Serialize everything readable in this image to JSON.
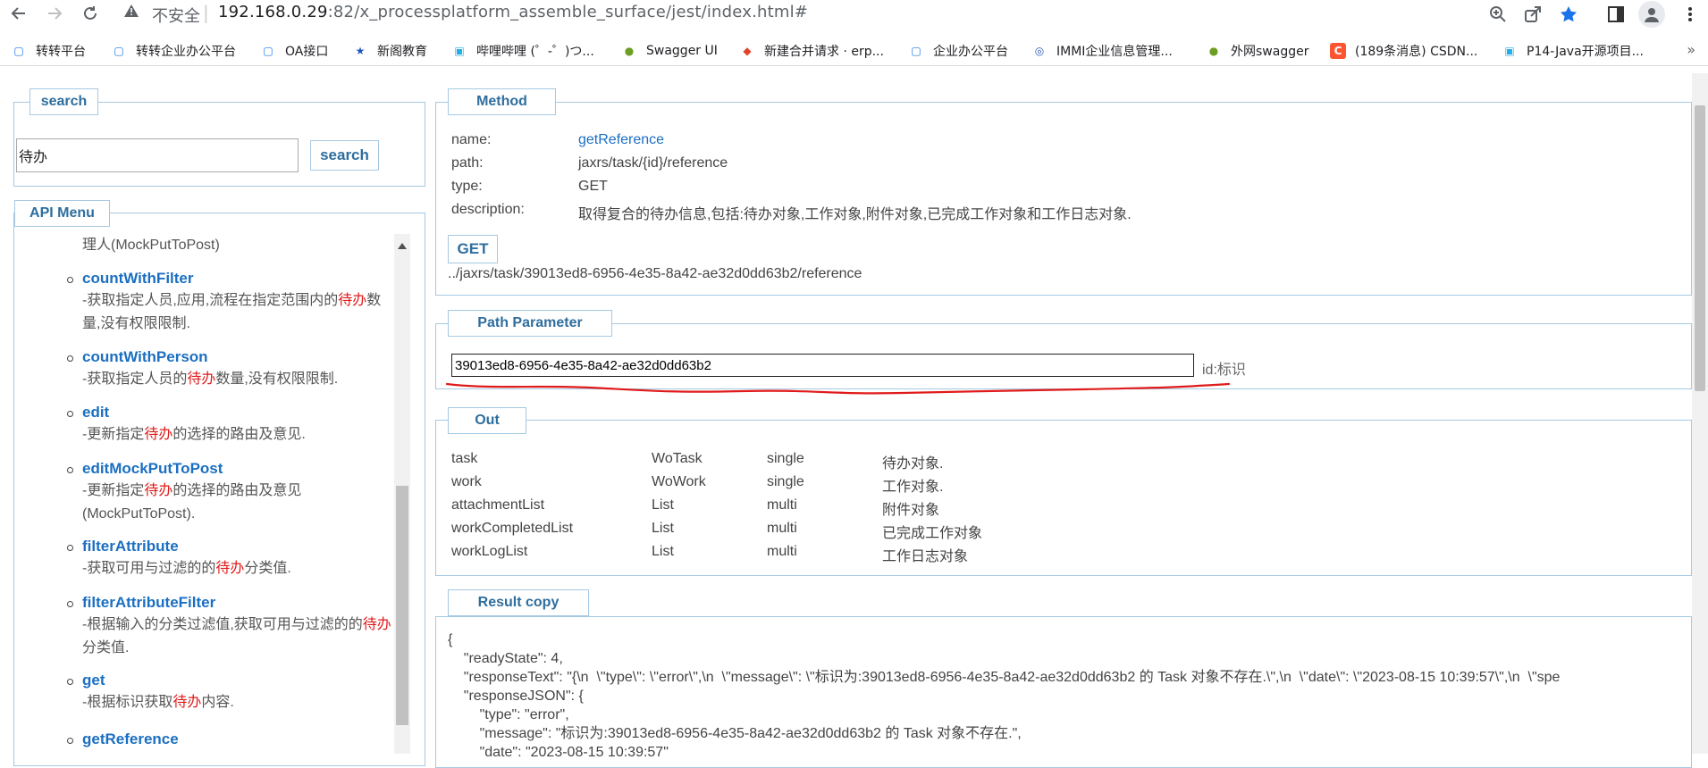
{
  "browser": {
    "insecure_label": "不安全",
    "url_host": "192.168.0.29",
    "url_rest": ":82/x_processplatform_assemble_surface/jest/index.html#"
  },
  "bookmarks": [
    {
      "label": "转转平台",
      "icon": "doc-icon",
      "color": "#1a73e8"
    },
    {
      "label": "转转企业办公平台",
      "icon": "doc-icon",
      "color": "#1a73e8"
    },
    {
      "label": "OA接口",
      "icon": "doc-icon",
      "color": "#1a73e8"
    },
    {
      "label": "新阁教育",
      "icon": "star-icon",
      "color": "#1a57c2"
    },
    {
      "label": "哔哩哔哩 (゜-゜)つ...",
      "icon": "bilibili-icon",
      "color": "#23ade5"
    },
    {
      "label": "Swagger UI",
      "icon": "swagger-icon",
      "color": "#6b9e23"
    },
    {
      "label": "新建合并请求 · erp...",
      "icon": "gitlab-icon",
      "color": "#e24329"
    },
    {
      "label": "企业办公平台",
      "icon": "doc-icon",
      "color": "#1a73e8"
    },
    {
      "label": "IMMI企业信息管理...",
      "icon": "globe-icon",
      "color": "#2c5fb3"
    },
    {
      "label": "外网swagger",
      "icon": "swagger-icon",
      "color": "#6b9e23"
    },
    {
      "label": "(189条消息) CSDN...",
      "icon": "csdn-icon",
      "color": "#fc5531"
    },
    {
      "label": "P14-Java开源项目...",
      "icon": "bilibili-icon",
      "color": "#23ade5"
    }
  ],
  "search": {
    "legend": "search",
    "value": "待办",
    "button": "search"
  },
  "api_menu": {
    "legend": "API Menu",
    "top_fragment": "理人(MockPutToPost)",
    "items": [
      {
        "name": "countWithFilter",
        "desc_parts": [
          "-获取指定人员,应用,流程在指定范围内的",
          "待办",
          "数量,没有权限限制."
        ]
      },
      {
        "name": "countWithPerson",
        "desc_parts": [
          "-获取指定人员的",
          "待办",
          "数量,没有权限限制."
        ]
      },
      {
        "name": "edit",
        "desc_parts": [
          "-更新指定",
          "待办",
          "的选择的路由及意见."
        ]
      },
      {
        "name": "editMockPutToPost",
        "desc_parts": [
          "-更新指定",
          "待办",
          "的选择的路由及意见(MockPutToPost)."
        ]
      },
      {
        "name": "filterAttribute",
        "desc_parts": [
          "-获取可用与过滤的的",
          "待办",
          "分类值."
        ]
      },
      {
        "name": "filterAttributeFilter",
        "desc_parts": [
          "-根据输入的分类过滤值,获取可用与过滤的的",
          "待办",
          "分类值."
        ]
      },
      {
        "name": "get",
        "desc_parts": [
          "-根据标识获取",
          "待办",
          "内容."
        ]
      },
      {
        "name": "getReference",
        "desc_parts": [
          "",
          "",
          ""
        ]
      }
    ]
  },
  "method": {
    "legend": "Method",
    "name_label": "name:",
    "name": "getReference",
    "path_label": "path:",
    "path": "jaxrs/task/{id}/reference",
    "type_label": "type:",
    "type": "GET",
    "desc_label": "description:",
    "description": "取得复合的待办信息,包括:待办对象,工作对象,附件对象,已完成工作对象和工作日志对象.",
    "button": "GET",
    "request_url": "../jaxrs/task/39013ed8-6956-4e35-8a42-ae32d0dd63b2/reference"
  },
  "path_parameter": {
    "legend": "Path Parameter",
    "value": "39013ed8-6956-4e35-8a42-ae32d0dd63b2",
    "hint": "id:标识"
  },
  "out": {
    "legend": "Out",
    "rows": [
      {
        "name": "task",
        "type": "WoTask",
        "mult": "single",
        "desc": "待办对象."
      },
      {
        "name": "work",
        "type": "WoWork",
        "mult": "single",
        "desc": "工作对象."
      },
      {
        "name": "attachmentList",
        "type": "List",
        "mult": "multi",
        "desc": "附件对象"
      },
      {
        "name": "workCompletedList",
        "type": "List",
        "mult": "multi",
        "desc": "已完成工作对象"
      },
      {
        "name": "workLogList",
        "type": "List",
        "mult": "multi",
        "desc": "工作日志对象"
      }
    ]
  },
  "result": {
    "legend": "Result copy",
    "lines": [
      "{",
      "    \"readyState\": 4,",
      "    \"responseText\": \"{\\n  \\\"type\\\": \\\"error\\\",\\n  \\\"message\\\": \\\"标识为:39013ed8-6956-4e35-8a42-ae32d0dd63b2 的 Task 对象不存在.\\\",\\n  \\\"date\\\": \\\"2023-08-15 10:39:57\\\",\\n  \\\"spe",
      "    \"responseJSON\": {",
      "        \"type\": \"error\",",
      "        \"message\": \"标识为:39013ed8-6956-4e35-8a42-ae32d0dd63b2 的 Task 对象不存在.\",",
      "        \"date\": \"2023-08-15 10:39:57\""
    ]
  },
  "colors": {
    "legend_text": "#2e6e9e",
    "border": "#a6c9e2",
    "link": "#1b6fc2",
    "highlight": "#e01b1b",
    "annotation": "#e01b1b"
  }
}
